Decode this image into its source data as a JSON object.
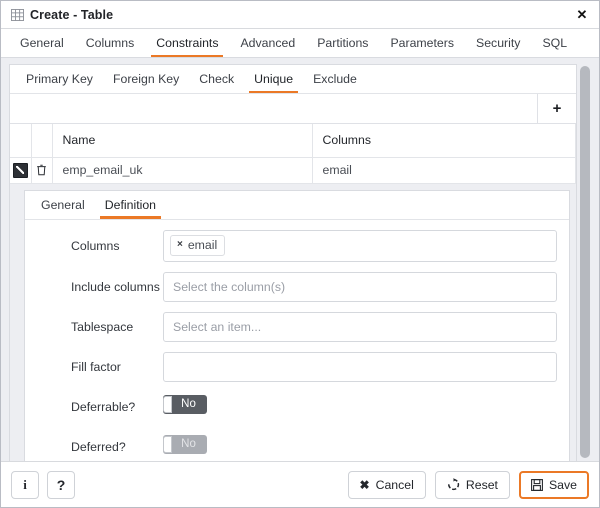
{
  "window": {
    "title": "Create - Table",
    "title_icon": "table-icon",
    "close_label": "✕"
  },
  "main_tabs": [
    {
      "label": "General",
      "active": false
    },
    {
      "label": "Columns",
      "active": false
    },
    {
      "label": "Constraints",
      "active": true
    },
    {
      "label": "Advanced",
      "active": false
    },
    {
      "label": "Partitions",
      "active": false
    },
    {
      "label": "Parameters",
      "active": false
    },
    {
      "label": "Security",
      "active": false
    },
    {
      "label": "SQL",
      "active": false
    }
  ],
  "sub_tabs": [
    {
      "label": "Primary Key",
      "active": false
    },
    {
      "label": "Foreign Key",
      "active": false
    },
    {
      "label": "Check",
      "active": false
    },
    {
      "label": "Unique",
      "active": true
    },
    {
      "label": "Exclude",
      "active": false
    }
  ],
  "grid": {
    "add_button": "+",
    "headers": [
      "Name",
      "Columns"
    ],
    "rows": [
      {
        "edit_icon": "edit-icon",
        "delete_icon": "trash-icon",
        "name": "emp_email_uk",
        "columns": "email"
      }
    ]
  },
  "inner_tabs": [
    {
      "label": "General",
      "active": false
    },
    {
      "label": "Definition",
      "active": true
    }
  ],
  "form": {
    "columns": {
      "label": "Columns",
      "chips": [
        "email"
      ],
      "chip_remove": "×"
    },
    "include_columns": {
      "label": "Include columns",
      "value": "",
      "placeholder": "Select the column(s)"
    },
    "tablespace": {
      "label": "Tablespace",
      "value": "",
      "placeholder": "Select an item..."
    },
    "fill_factor": {
      "label": "Fill factor",
      "value": "",
      "placeholder": ""
    },
    "deferrable": {
      "label": "Deferrable?",
      "value": "No",
      "state": "enabled"
    },
    "deferred": {
      "label": "Deferred?",
      "value": "No",
      "state": "disabled"
    }
  },
  "footer": {
    "info_label": "i",
    "help_label": "?",
    "cancel_label": "Cancel",
    "reset_label": "Reset",
    "save_label": "Save"
  },
  "colors": {
    "accent": "#eb7926",
    "panel_bg": "#edeef2",
    "toggle_on": "#595d63",
    "toggle_disabled": "#a9acb2"
  }
}
